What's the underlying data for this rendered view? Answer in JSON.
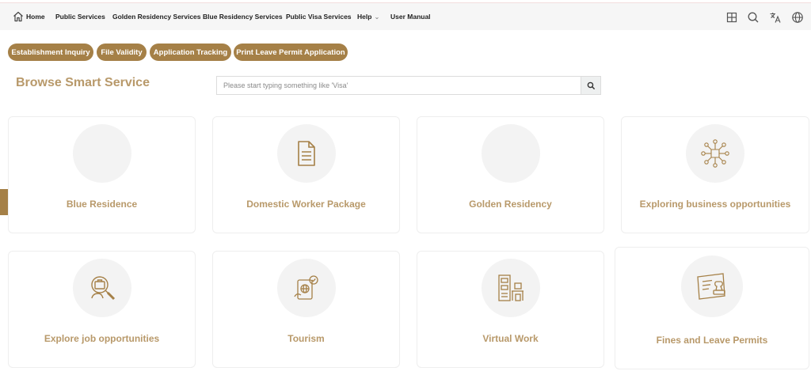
{
  "nav": {
    "items": [
      {
        "label": "Home"
      },
      {
        "label": "Public Services"
      },
      {
        "label": "Golden Residency Services"
      },
      {
        "label": "Blue Residency Services"
      },
      {
        "label": "Public Visa Services"
      },
      {
        "label": "Help"
      },
      {
        "label": "User Manual"
      }
    ],
    "right_icons": [
      "grid-icon",
      "search-icon",
      "translate-icon",
      "globe-icon"
    ]
  },
  "quick_links": [
    {
      "label": "Establishment Inquiry"
    },
    {
      "label": "File Validity"
    },
    {
      "label": "Application Tracking"
    },
    {
      "label": "Print Leave Permit Application"
    }
  ],
  "page": {
    "title": "Browse Smart Service",
    "search_placeholder": "Please start typing something like 'Visa'"
  },
  "services": [
    {
      "label": "Blue Residence",
      "icon": "none"
    },
    {
      "label": "Domestic Worker Package",
      "icon": "document-icon"
    },
    {
      "label": "Golden Residency",
      "icon": "none"
    },
    {
      "label": "Exploring business opportunities",
      "icon": "network-icon"
    },
    {
      "label": "Explore job opportunities",
      "icon": "job-search-icon"
    },
    {
      "label": "Tourism",
      "icon": "tourism-icon"
    },
    {
      "label": "Virtual Work",
      "icon": "office-icon"
    },
    {
      "label": "Fines and Leave Permits",
      "icon": "stamp-icon"
    }
  ],
  "colors": {
    "accent": "#a58047",
    "label": "#b8996a",
    "nav_bg": "#f6f6f6"
  }
}
